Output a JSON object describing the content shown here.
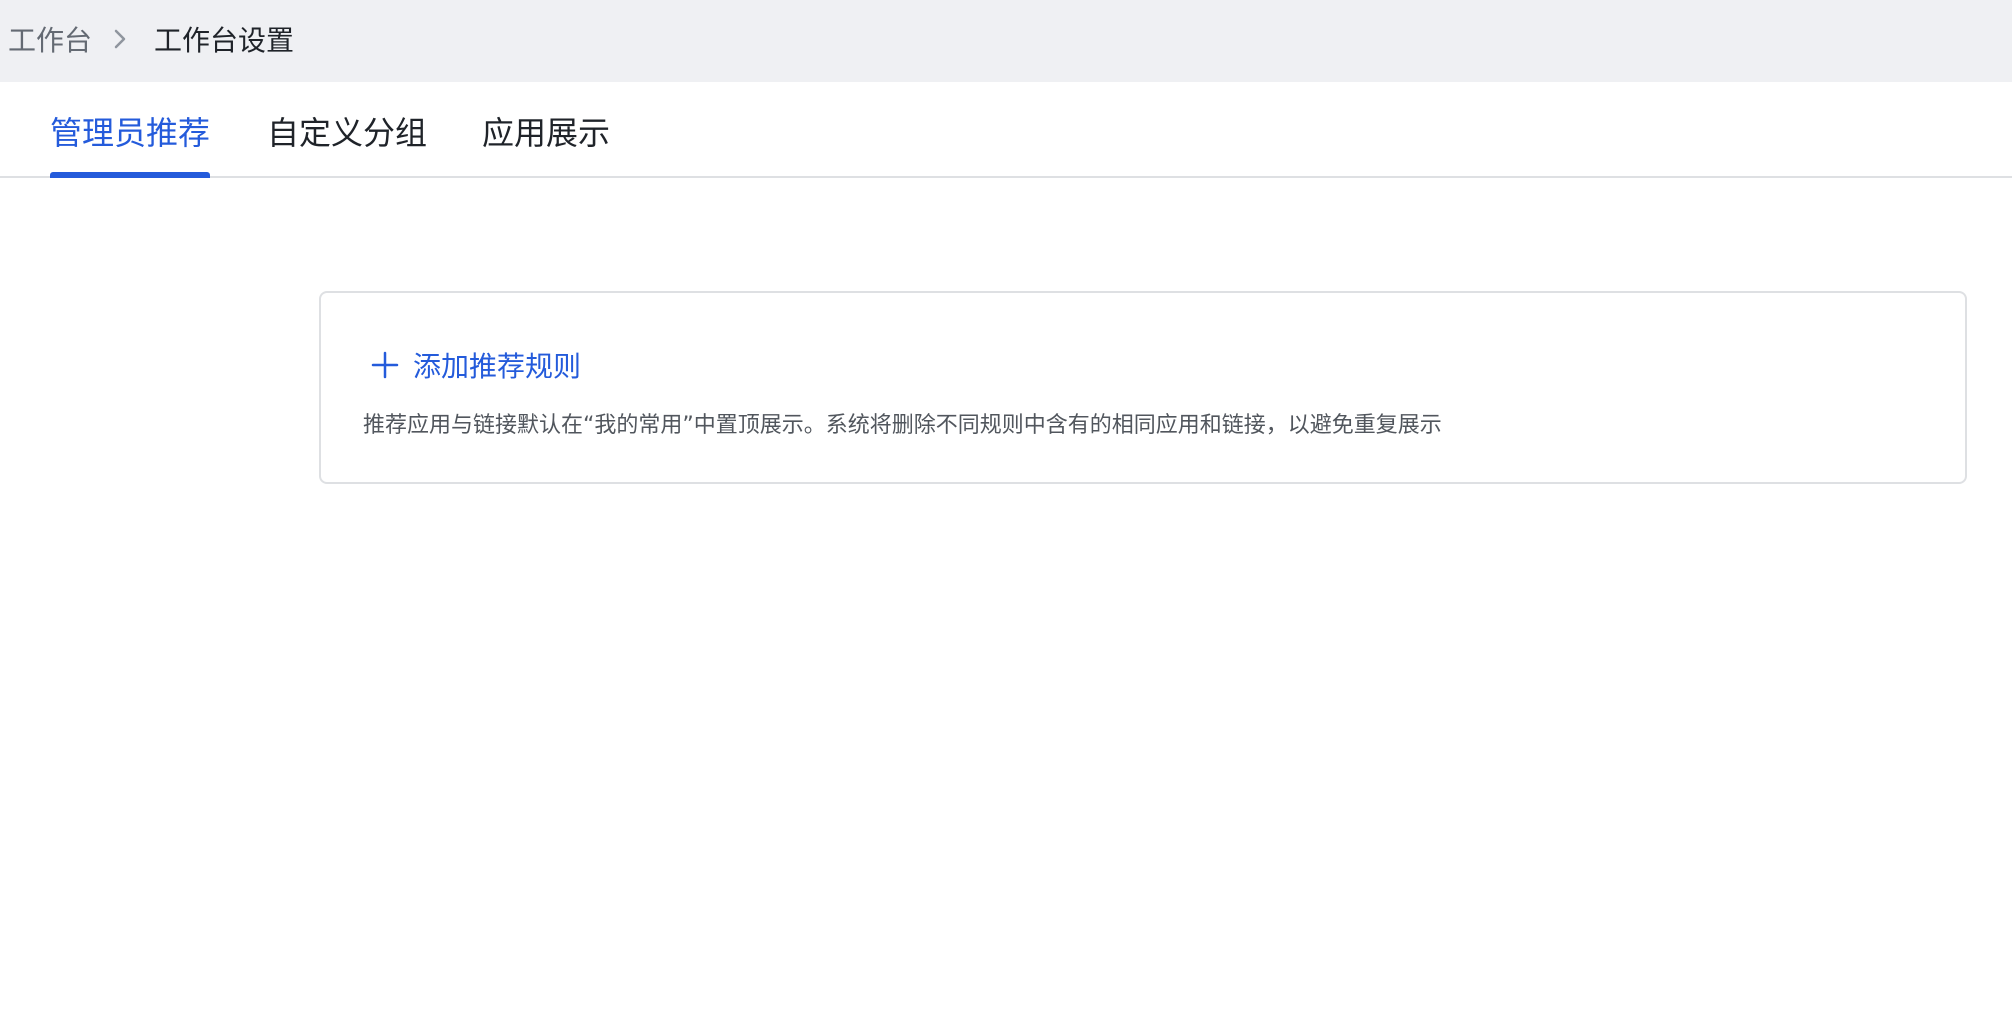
{
  "breadcrumb": {
    "parent": "工作台",
    "current": "工作台设置"
  },
  "tabs": [
    {
      "label": "管理员推荐",
      "active": true
    },
    {
      "label": "自定义分组",
      "active": false
    },
    {
      "label": "应用展示",
      "active": false
    }
  ],
  "rule_card": {
    "add_label": "添加推荐规则",
    "description": "推荐应用与链接默认在“我的常用”中置顶展示。系统将删除不同规则中含有的相同应用和链接，以避免重复展示"
  },
  "icons": {
    "breadcrumb_separator": "chevron-right-icon",
    "add": "plus-icon"
  },
  "colors": {
    "accent": "#245bdb",
    "header_bg": "#eff0f3",
    "text_primary": "#1f2329",
    "text_secondary": "#646a73",
    "border": "#dee0e3"
  }
}
